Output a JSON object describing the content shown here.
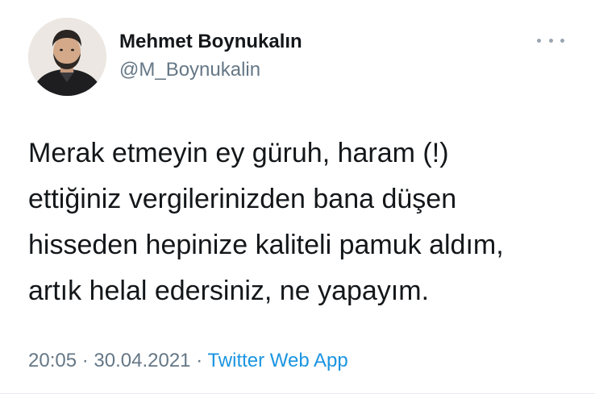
{
  "user": {
    "display_name": "Mehmet Boynukalın",
    "handle": "@M_Boynukalin"
  },
  "tweet": {
    "lines": [
      "Merak etmeyin ey güruh, haram (!)",
      "ettiğiniz vergilerinizden bana düşen",
      "hisseden hepinize kaliteli pamuk aldım,",
      "artık helal edersiniz, ne yapayım."
    ],
    "time": "20:05",
    "separator": "·",
    "date": "30.04.2021",
    "source": "Twitter Web App"
  },
  "icons": {
    "more": "more-horizontal-icon"
  },
  "colors": {
    "text": "#14171a",
    "secondary": "#657786",
    "link": "#1b95e0"
  }
}
